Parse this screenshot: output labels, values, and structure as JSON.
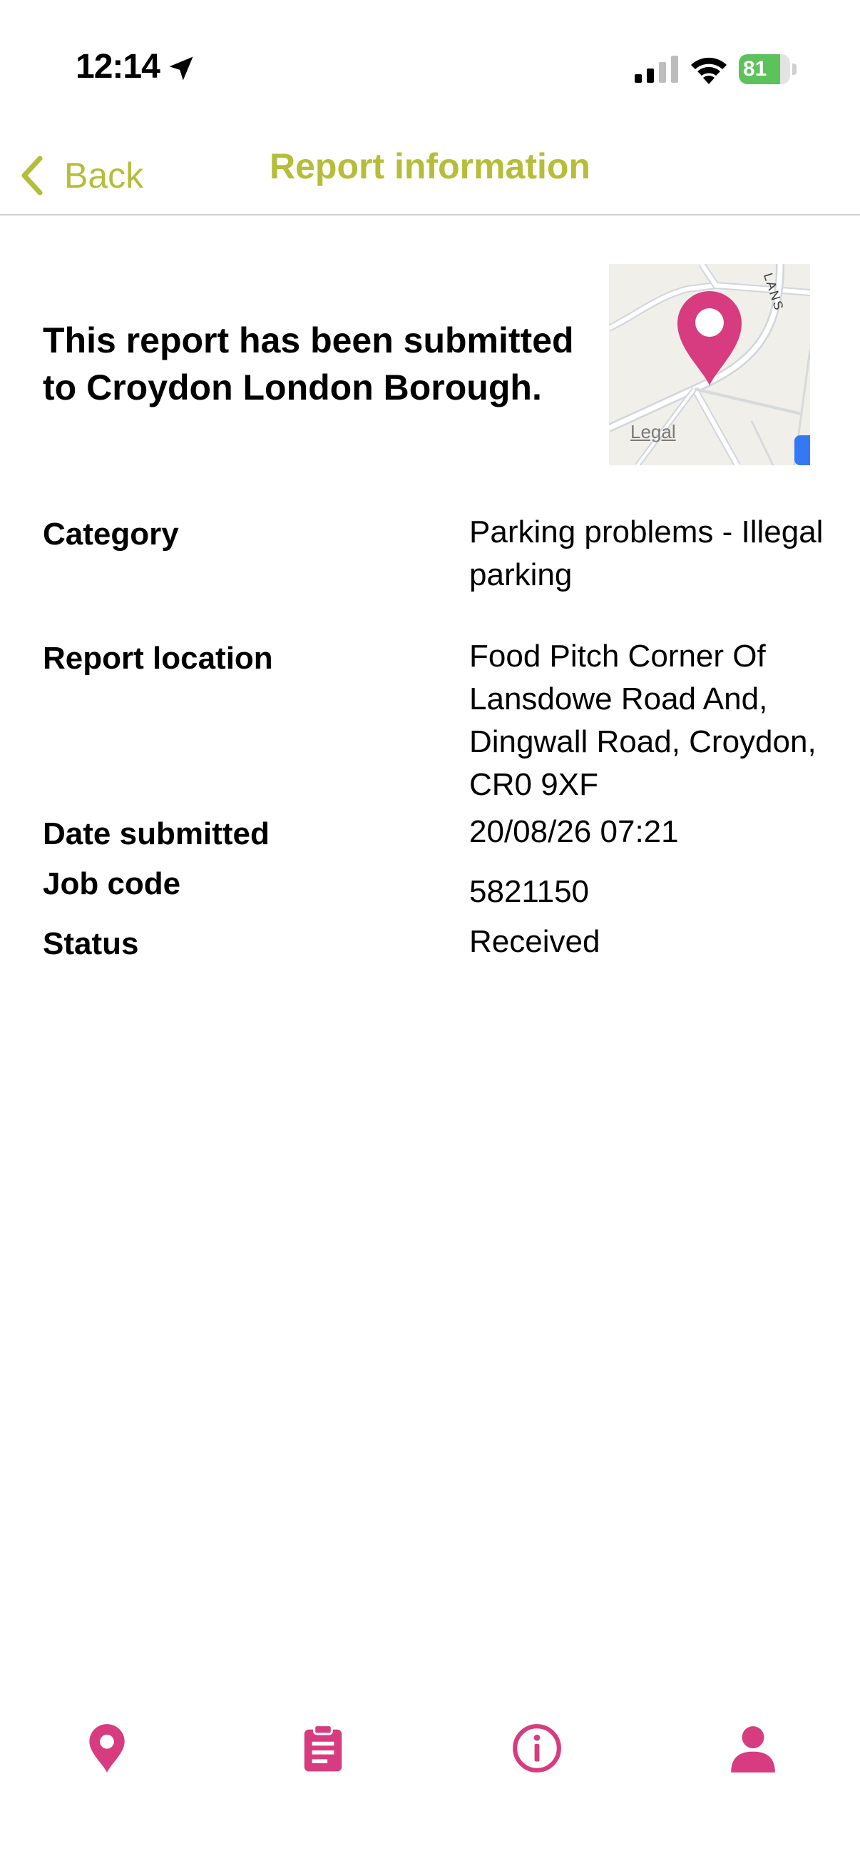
{
  "status_bar": {
    "time": "12:14",
    "battery_percent": "81",
    "battery_level": 0.81,
    "battery_color": "#5cc25a",
    "icons": [
      "location-arrow-icon",
      "cellular-signal-icon",
      "wifi-icon",
      "battery-charging-icon"
    ]
  },
  "nav": {
    "back_label": "Back",
    "title": "Report information",
    "accent_color": "#b5bd39"
  },
  "headline": "This report has been submitted to Croydon London Borough.",
  "map": {
    "legal_label": "Legal",
    "street_label": "LANS",
    "pin_color": "#d63c7f"
  },
  "details": [
    {
      "label": "Category",
      "value": "Parking problems - Illegal parking"
    },
    {
      "label": "Report location",
      "value": "Food Pitch Corner Of Lansdowe Road And, Dingwall Road, Croydon, CR0 9XF"
    },
    {
      "label": "Date submitted",
      "value": "20/08/26 07:21"
    },
    {
      "label": "Job code",
      "value": "5821150"
    },
    {
      "label": "Status",
      "value": "Received"
    }
  ],
  "tabbar": {
    "color": "#d63c7f",
    "tabs": [
      {
        "icon": "map-pin-icon"
      },
      {
        "icon": "clipboard-icon"
      },
      {
        "icon": "info-icon"
      },
      {
        "icon": "user-icon"
      }
    ]
  }
}
